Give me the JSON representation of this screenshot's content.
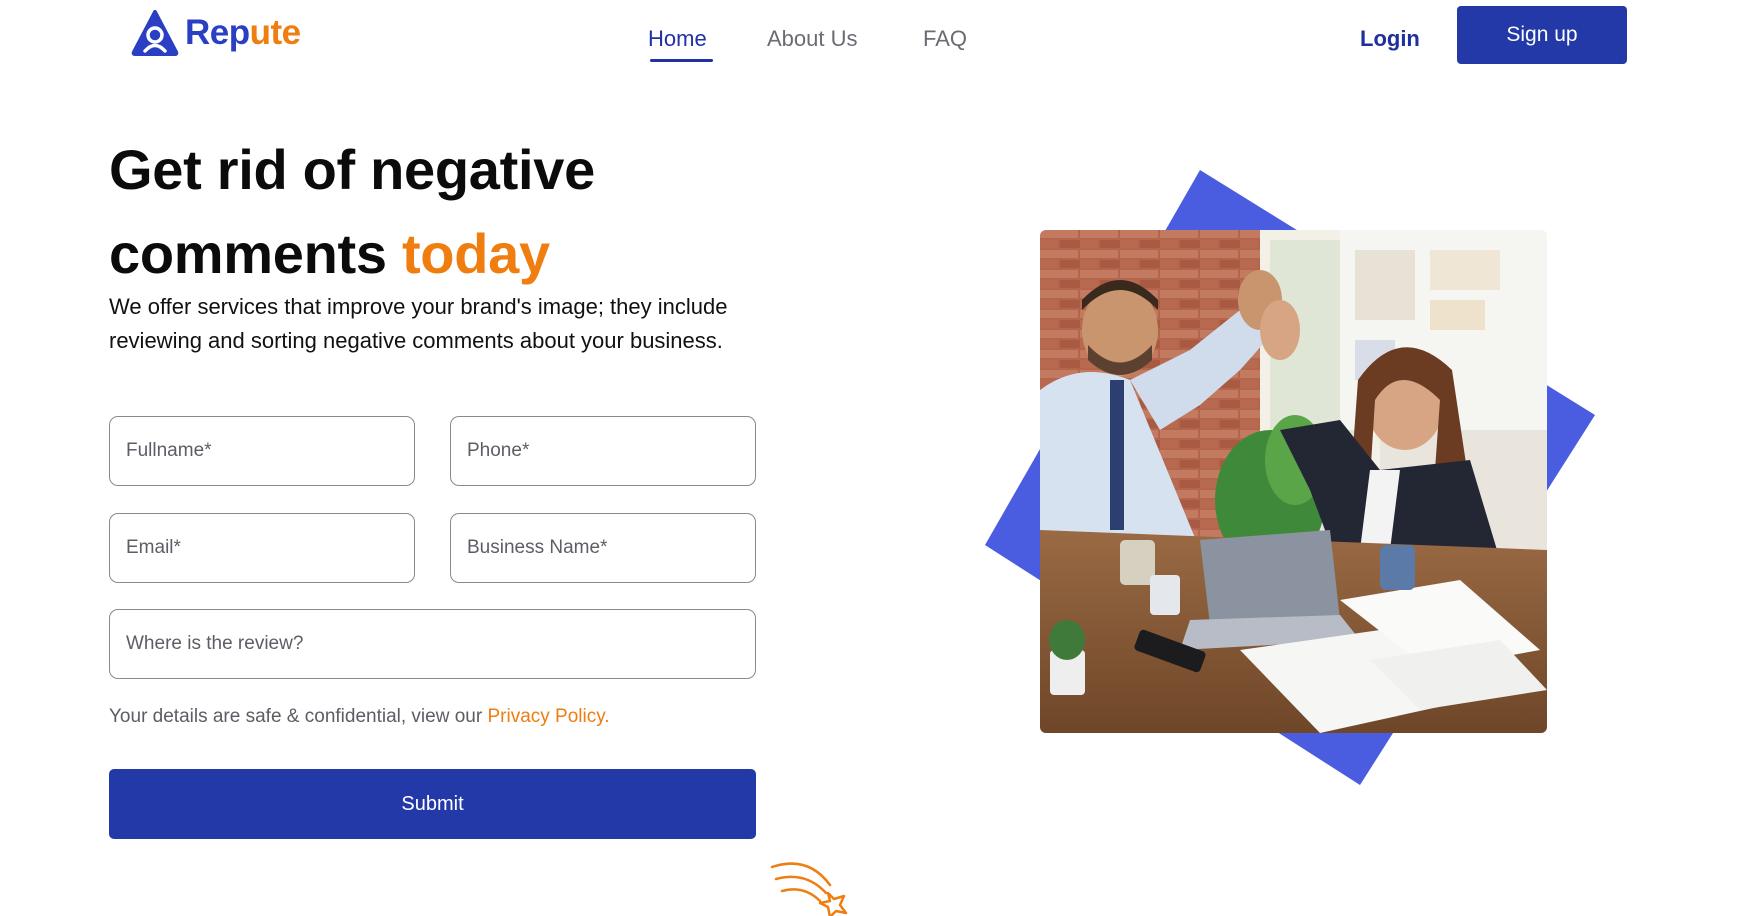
{
  "brand": {
    "name_part1": "Rep",
    "name_part2": "ute",
    "colors": {
      "primary": "#2339a8",
      "accent": "#ef7d10",
      "logo_blue": "#2b3fc4",
      "shape_blue": "#4a5ce0"
    }
  },
  "nav": {
    "links": [
      {
        "label": "Home",
        "active": true
      },
      {
        "label": "About Us",
        "active": false
      },
      {
        "label": "FAQ",
        "active": false
      }
    ],
    "login_label": "Login",
    "signup_label": "Sign up"
  },
  "hero": {
    "title_line1": "Get rid of negative",
    "title_line2": "comments",
    "title_accent": "today",
    "subtitle": "We offer services that improve your brand's image; they include reviewing and sorting negative comments about your business."
  },
  "form": {
    "fullname_placeholder": "Fullname*",
    "phone_placeholder": "Phone*",
    "email_placeholder": "Email*",
    "business_placeholder": "Business Name*",
    "where_placeholder": "Where is the review?",
    "privacy_text": "Your details are safe & confidential, view our ",
    "privacy_link": "Privacy Policy.",
    "submit_label": "Submit"
  },
  "icons": {
    "logo": "user-pin-icon",
    "decor": "shooting-star-icon"
  }
}
